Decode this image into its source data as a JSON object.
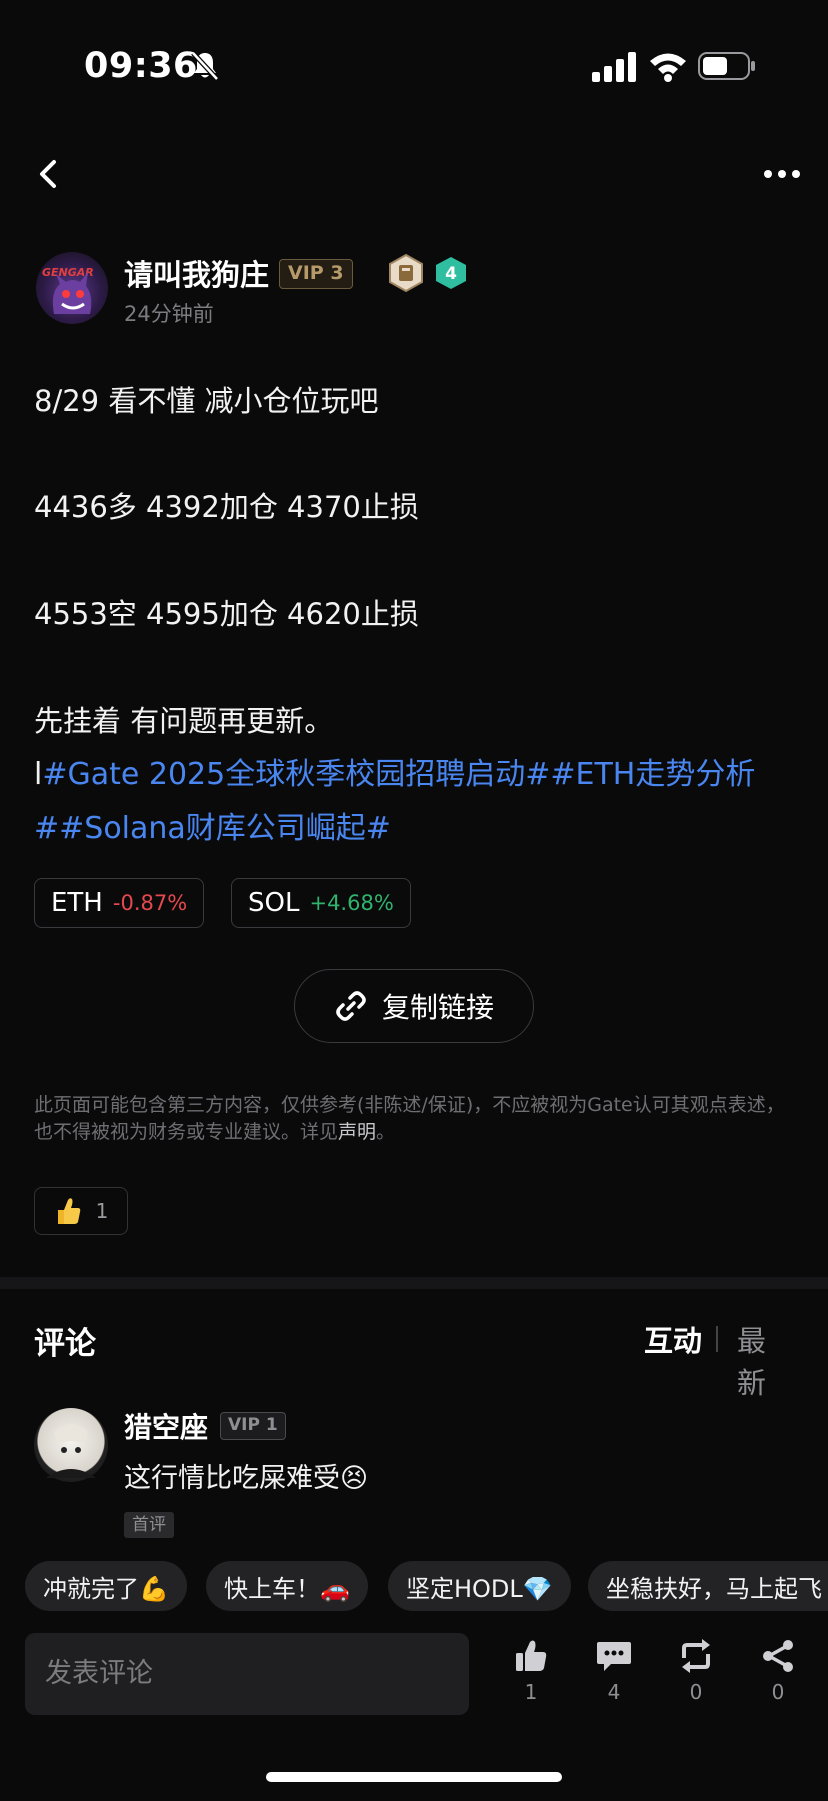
{
  "status_bar": {
    "time": "09:36"
  },
  "author": {
    "name": "请叫我狗庄",
    "vip": "VIP 3",
    "level": "4",
    "avatar_text": "GENGAR",
    "post_time": "24分钟前"
  },
  "post": {
    "line1": "8/29 看不懂 减小仓位玩吧",
    "line2": "4436多 4392加仓 4370止损",
    "line3": "4553空 4595加仓 4620止损",
    "line4": "先挂着  有问题再更新。",
    "cursor": "l",
    "hashtags": "#Gate 2025全球秋季校园招聘启动##ETH走势分析##Solana财库公司崛起#"
  },
  "tickers": [
    {
      "symbol": "ETH",
      "change": "-0.87%"
    },
    {
      "symbol": "SOL",
      "change": "+4.68%"
    }
  ],
  "copy_link": "复制链接",
  "disclaimer": {
    "text": "此页面可能包含第三方内容，仅供参考(非陈述/保证)，不应被视为Gate认可其观点表述，也不得被视为财务或专业建议。详见",
    "link": "声明",
    "end": "。"
  },
  "likes": {
    "count": "1"
  },
  "comments": {
    "title": "评论",
    "sort_hot": "互动",
    "sort_new": "最新",
    "items": [
      {
        "name": "猎空座",
        "vip": "VIP 1",
        "text": "这行情比吃屎难受😣",
        "badge": "首评"
      }
    ]
  },
  "quick_replies": [
    "冲就完了💪",
    "快上车！🚗",
    "坚定HODL💎",
    "坐稳扶好，马上起飞"
  ],
  "bottom_bar": {
    "placeholder": "发表评论",
    "like_count": "1",
    "comment_count": "4",
    "repost_count": "0",
    "share_count": "0"
  },
  "colors": {
    "background": "#0a0a0b",
    "hashtag": "#4a86f0",
    "down": "#e5484d",
    "up": "#30b36c",
    "vip_gold": "#b69a6a"
  },
  "icons": [
    "bell-slash-icon",
    "signal-icon",
    "wifi-icon",
    "battery-icon",
    "back-icon",
    "more-icon",
    "medal-icon",
    "level-icon",
    "link-icon",
    "thumbs-up-icon",
    "comment-icon",
    "repost-icon",
    "share-icon"
  ]
}
